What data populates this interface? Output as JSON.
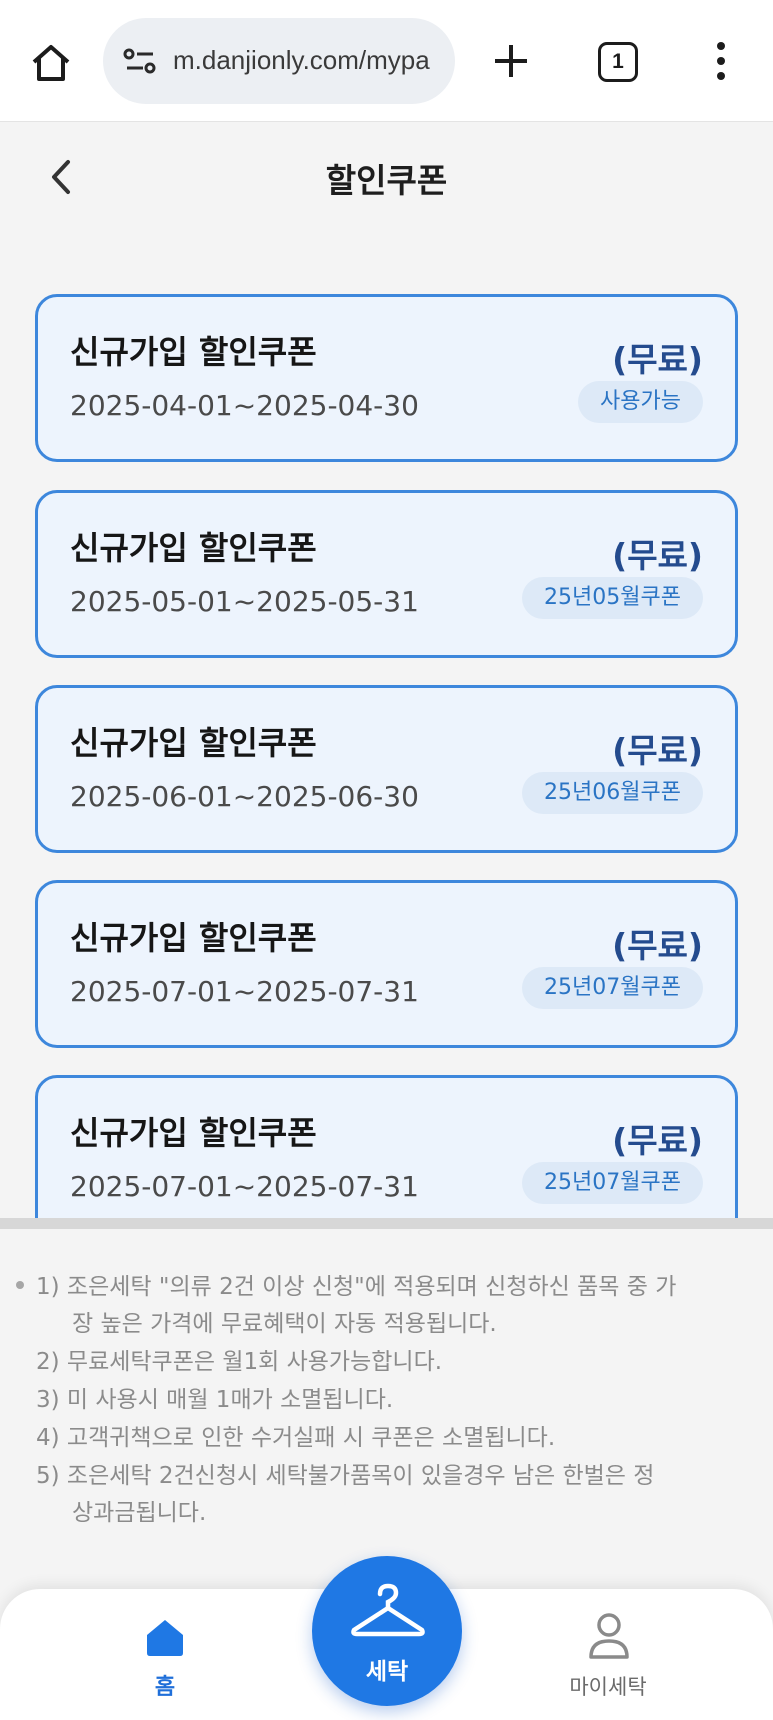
{
  "browser": {
    "url": "m.danjionly.com/mypa",
    "tab_count": "1",
    "icons": [
      "home-icon",
      "site-settings-icon",
      "new-tab-plus-icon",
      "tab-switcher-icon",
      "overflow-menu-icon"
    ]
  },
  "header": {
    "title": "할인쿠폰",
    "back_icon": "chevron-left-icon"
  },
  "coupons": [
    {
      "name": "신규가입 할인쿠폰",
      "price": "(무료)",
      "period": "2025-04-01~2025-04-30",
      "status": "사용가능"
    },
    {
      "name": "신규가입 할인쿠폰",
      "price": "(무료)",
      "period": "2025-05-01~2025-05-31",
      "status": "25년05월쿠폰"
    },
    {
      "name": "신규가입 할인쿠폰",
      "price": "(무료)",
      "period": "2025-06-01~2025-06-30",
      "status": "25년06월쿠폰"
    },
    {
      "name": "신규가입 할인쿠폰",
      "price": "(무료)",
      "period": "2025-07-01~2025-07-31",
      "status": "25년07월쿠폰"
    },
    {
      "name": "신규가입 할인쿠폰",
      "price": "(무료)",
      "period": "2025-07-01~2025-07-31",
      "status": "25년07월쿠폰"
    }
  ],
  "notes": {
    "lines": [
      "1)  조은세탁 \"의류 2건 이상 신청\"에 적용되며 신청하신 품목 중 가",
      "장 높은 가격에 무료혜택이 자동 적용됩니다.",
      "2) 무료세탁쿠폰은 월1회 사용가능합니다.",
      "3) 미 사용시 매월 1매가 소멸됩니다.",
      "4) 고객귀책으로 인한 수거실패 시 쿠폰은 소멸됩니다.",
      "5) 조은세탁 2건신청시 세탁불가품목이 있을경우 남은 한벌은 정",
      "상과금됩니다."
    ]
  },
  "bottom_nav": {
    "home_label": "홈",
    "wash_label": "세탁",
    "my_label": "마이세탁",
    "icons": [
      "home-icon",
      "hanger-icon",
      "user-icon"
    ]
  },
  "colors": {
    "accent": "#1f78e4",
    "card_border": "#3d87dc",
    "card_bg": "#edf4fd",
    "price": "#244b8e",
    "badge_text": "#2a74c4"
  }
}
